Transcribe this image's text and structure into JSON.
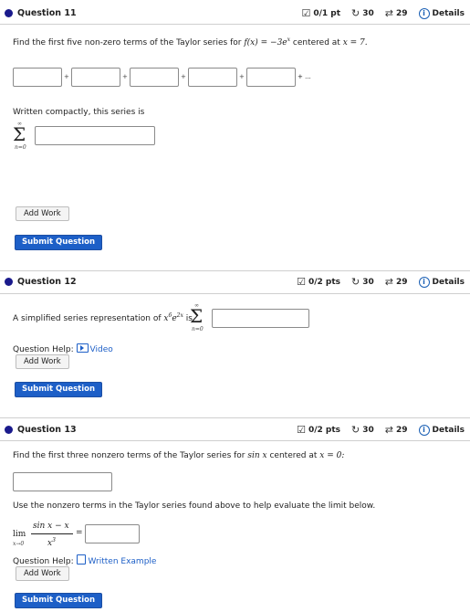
{
  "q11": {
    "title": "Question 11",
    "score": "0/1 pt",
    "retries": "30",
    "attempts": "29",
    "details": "Details",
    "prompt_pre": "Find the first five non-zero terms of the Taylor series for",
    "func": "f(x) = −3e",
    "func_exp": "x",
    "prompt_mid": "centered at",
    "center": "x = 7.",
    "ellipsis": "+ ...",
    "compact": "Written compactly, this series is",
    "sum_top": "∞",
    "sum_bottom": "n=0",
    "add_work": "Add Work",
    "submit": "Submit Question"
  },
  "q12": {
    "title": "Question 12",
    "score": "0/2 pts",
    "retries": "30",
    "attempts": "29",
    "details": "Details",
    "prompt_pre": "A simplified series representation of",
    "expr": "x",
    "exp1": "6",
    "expr2": "e",
    "exp2": "2x",
    "is": "is",
    "sum_top": "∞",
    "sum_bottom": "n=0",
    "help_label": "Question Help:",
    "help_link": "Video",
    "add_work": "Add Work",
    "submit": "Submit Question"
  },
  "q13": {
    "title": "Question 13",
    "score": "0/2 pts",
    "retries": "30",
    "attempts": "29",
    "details": "Details",
    "prompt_pre": "Find the first three nonzero terms of the Taylor series for",
    "sinx": "sin x",
    "prompt_mid": "centered at",
    "center": "x = 0:",
    "use_text": "Use the nonzero terms in the Taylor series found above to help evaluate the limit below.",
    "lim": "lim",
    "lim_sub": "x→0",
    "numerator": "sin x − x",
    "denominator": "x",
    "den_exp": "3",
    "equals": "=",
    "help_label": "Question Help:",
    "help_link": "Written Example",
    "add_work": "Add Work",
    "submit": "Submit Question"
  },
  "icons": {
    "score": "clipboard-check-icon",
    "retries": "redo-icon",
    "attempts": "sync-arrows-icon",
    "details": "info-icon"
  },
  "colors": {
    "primary": "#1d5fc7",
    "bullet": "#1a1a8c"
  }
}
